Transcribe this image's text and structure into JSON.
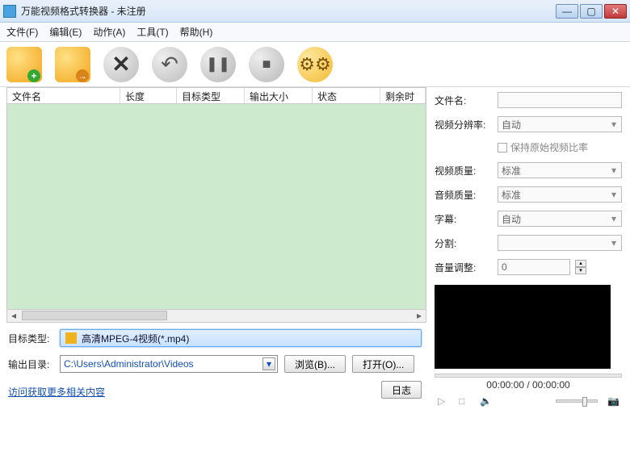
{
  "title": "万能视频格式转换器 - 未注册",
  "menu": {
    "file": "文件(F)",
    "edit": "编辑(E)",
    "action": "动作(A)",
    "tools": "工具(T)",
    "help": "帮助(H)"
  },
  "list": {
    "cols": {
      "name": "文件名",
      "length": "长度",
      "type": "目标类型",
      "size": "输出大小",
      "status": "状态",
      "remain": "剩余时"
    }
  },
  "target": {
    "label": "目标类型:",
    "value": "高清MPEG-4视频(*.mp4)"
  },
  "output": {
    "label": "输出目录:",
    "value": "C:\\Users\\Administrator\\Videos",
    "browse": "浏览(B)...",
    "open": "打开(O)..."
  },
  "link": "访问获取更多相关内容",
  "logbtn": "日志",
  "props": {
    "filename": {
      "label": "文件名:",
      "value": ""
    },
    "resolution": {
      "label": "视频分辨率:",
      "value": "自动"
    },
    "keepratio": "保持原始视频比率",
    "vquality": {
      "label": "视频质量:",
      "value": "标准"
    },
    "aquality": {
      "label": "音频质量:",
      "value": "标准"
    },
    "subtitle": {
      "label": "字幕:",
      "value": "自动"
    },
    "split": {
      "label": "分割:",
      "value": ""
    },
    "volume": {
      "label": "音量调整:",
      "value": "0"
    }
  },
  "time": "00:00:00 / 00:00:00"
}
